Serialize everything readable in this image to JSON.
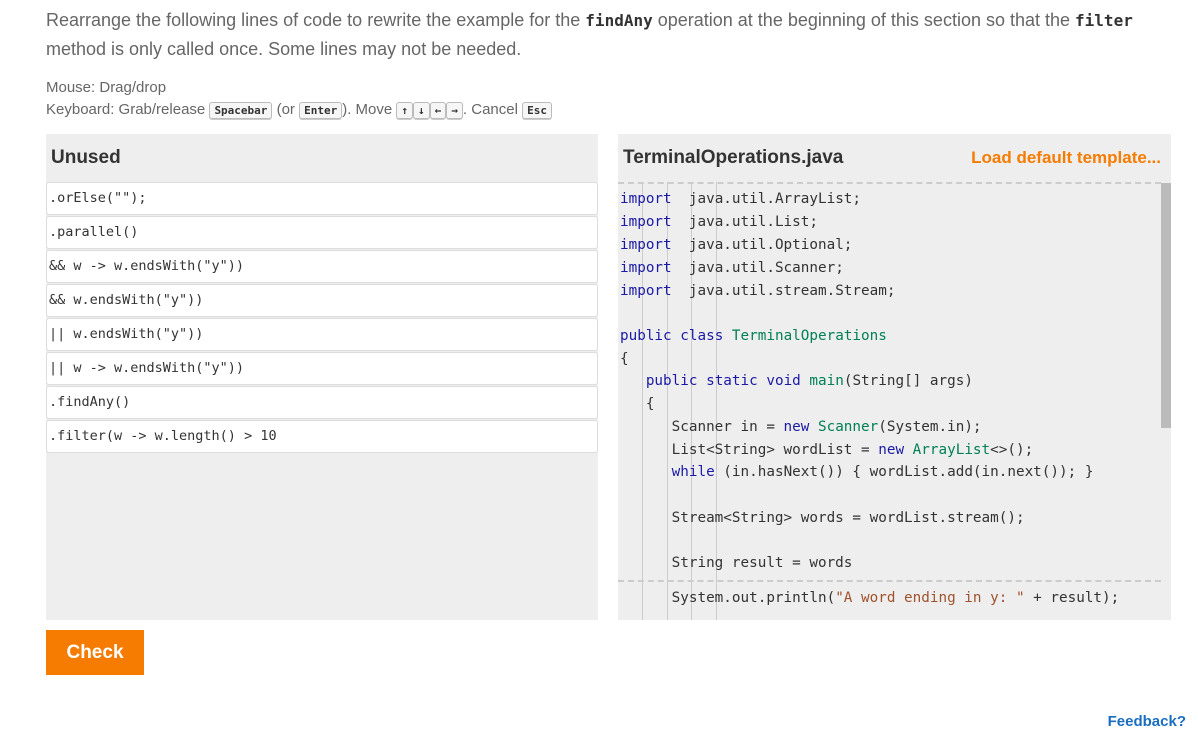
{
  "prompt": {
    "p1": "Rearrange the following lines of code to rewrite the example for the ",
    "c1": "findAny",
    "p2": " operation at the beginning of this section so that the ",
    "c2": "filter",
    "p3": " method is only called once. Some lines may not be needed."
  },
  "help": {
    "mouse": "Mouse: Drag/drop",
    "kb1": "Keyboard: Grab/release ",
    "space": "Spacebar",
    "kb2": " (or ",
    "enter": "Enter",
    "kb3": "). Move ",
    "up": "↑",
    "down": "↓",
    "left": "←",
    "right": "→",
    "kb4": ". Cancel ",
    "esc": "Esc"
  },
  "unused": {
    "title": "Unused",
    "items": [
      ".orElse(\"\");",
      ".parallel()",
      "&& w -> w.endsWith(\"y\"))",
      "&& w.endsWith(\"y\"))",
      "|| w.endsWith(\"y\"))",
      "|| w -> w.endsWith(\"y\"))",
      ".findAny()",
      ".filter(w -> w.length() > 10"
    ]
  },
  "editor": {
    "title": "TerminalOperations.java",
    "load": "Load default template...",
    "lines": [
      [
        [
          "k",
          "import"
        ],
        [
          "",
          "  java.util.ArrayList;"
        ]
      ],
      [
        [
          "k",
          "import"
        ],
        [
          "",
          "  java.util.List;"
        ]
      ],
      [
        [
          "k",
          "import"
        ],
        [
          "",
          "  java.util.Optional;"
        ]
      ],
      [
        [
          "k",
          "import"
        ],
        [
          "",
          "  java.util.Scanner;"
        ]
      ],
      [
        [
          "k",
          "import"
        ],
        [
          "",
          "  java.util.stream.Stream;"
        ]
      ],
      [],
      [
        [
          "k",
          "public"
        ],
        [
          "",
          " "
        ],
        [
          "k",
          "class"
        ],
        [
          "",
          " "
        ],
        [
          "t",
          "TerminalOperations"
        ]
      ],
      [
        [
          "",
          "{"
        ]
      ],
      [
        [
          "",
          "   "
        ],
        [
          "k",
          "public"
        ],
        [
          "",
          " "
        ],
        [
          "k",
          "static"
        ],
        [
          "",
          " "
        ],
        [
          "k",
          "void"
        ],
        [
          "",
          " "
        ],
        [
          "t",
          "main"
        ],
        [
          "",
          "(String[] args)"
        ]
      ],
      [
        [
          "",
          "   {"
        ]
      ],
      [
        [
          "",
          "      Scanner in = "
        ],
        [
          "k",
          "new"
        ],
        [
          "",
          " "
        ],
        [
          "t",
          "Scanner"
        ],
        [
          "",
          "(System.in);"
        ]
      ],
      [
        [
          "",
          "      List<String> wordList = "
        ],
        [
          "k",
          "new"
        ],
        [
          "",
          " "
        ],
        [
          "t",
          "ArrayList"
        ],
        [
          "",
          "<>();"
        ]
      ],
      [
        [
          "",
          "      "
        ],
        [
          "k",
          "while"
        ],
        [
          "",
          " (in.hasNext()) { wordList.add(in.next()); }"
        ]
      ],
      [],
      [
        [
          "",
          "      Stream<String> words = wordList.stream();"
        ]
      ],
      [],
      [
        [
          "",
          "      String result = words"
        ]
      ]
    ],
    "after": [
      [
        "",
        "      System.out.println("
      ],
      [
        "s",
        "\"A word ending in y: \""
      ],
      [
        "",
        " + result);"
      ]
    ]
  },
  "check": "Check",
  "feedback": "Feedback?"
}
